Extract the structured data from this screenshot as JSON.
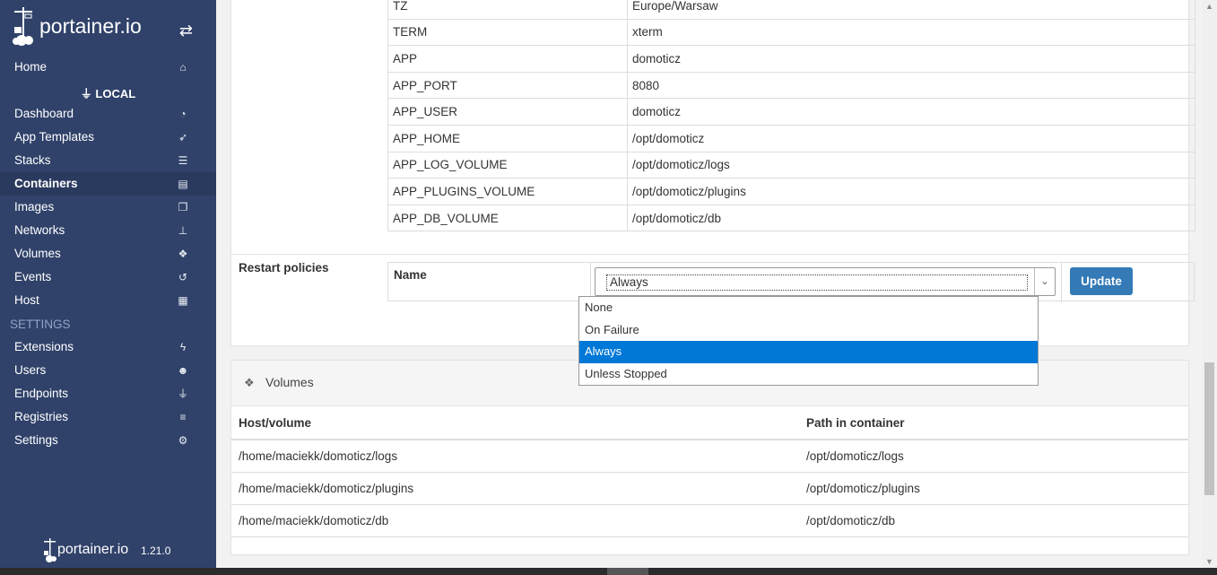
{
  "sidebar": {
    "brand": "portainer.io",
    "toggle_icon": "exchange-icon",
    "endpoint_label": "LOCAL",
    "settings_title": "SETTINGS",
    "items": [
      {
        "label": "Home",
        "icon": "home-icon"
      },
      {
        "label": "Dashboard",
        "icon": "tachometer-icon"
      },
      {
        "label": "App Templates",
        "icon": "rocket-icon"
      },
      {
        "label": "Stacks",
        "icon": "th-list-icon"
      },
      {
        "label": "Containers",
        "icon": "server-icon",
        "active": true
      },
      {
        "label": "Images",
        "icon": "clone-icon"
      },
      {
        "label": "Networks",
        "icon": "sitemap-icon"
      },
      {
        "label": "Volumes",
        "icon": "cubes-icon"
      },
      {
        "label": "Events",
        "icon": "history-icon"
      },
      {
        "label": "Host",
        "icon": "th-icon"
      }
    ],
    "settings_items": [
      {
        "label": "Extensions",
        "icon": "bolt-icon"
      },
      {
        "label": "Users",
        "icon": "users-icon"
      },
      {
        "label": "Endpoints",
        "icon": "plug-icon"
      },
      {
        "label": "Registries",
        "icon": "database-icon"
      },
      {
        "label": "Settings",
        "icon": "cogs-icon"
      }
    ],
    "footer_brand": "portainer.io",
    "version": "1.21.0"
  },
  "env": {
    "rows": [
      {
        "key": "TZ",
        "value": "Europe/Warsaw"
      },
      {
        "key": "TERM",
        "value": "xterm"
      },
      {
        "key": "APP",
        "value": "domoticz"
      },
      {
        "key": "APP_PORT",
        "value": "8080"
      },
      {
        "key": "APP_USER",
        "value": "domoticz"
      },
      {
        "key": "APP_HOME",
        "value": "/opt/domoticz"
      },
      {
        "key": "APP_LOG_VOLUME",
        "value": "/opt/domoticz/logs"
      },
      {
        "key": "APP_PLUGINS_VOLUME",
        "value": "/opt/domoticz/plugins"
      },
      {
        "key": "APP_DB_VOLUME",
        "value": "/opt/domoticz/db"
      }
    ]
  },
  "restart": {
    "label": "Restart policies",
    "name_label": "Name",
    "selected": "Always",
    "options": [
      "None",
      "On Failure",
      "Always",
      "Unless Stopped"
    ],
    "update_label": "Update"
  },
  "volumes": {
    "title": "Volumes",
    "icon": "cubes-icon",
    "col_host": "Host/volume",
    "col_path": "Path in container",
    "rows": [
      {
        "host": "/home/maciekk/domoticz/logs",
        "path": "/opt/domoticz/logs"
      },
      {
        "host": "/home/maciekk/domoticz/plugins",
        "path": "/opt/domoticz/plugins"
      },
      {
        "host": "/home/maciekk/domoticz/db",
        "path": "/opt/domoticz/db"
      }
    ]
  },
  "colors": {
    "sidebar_bg": "#30426a",
    "accent": "#337ab7",
    "dropdown_selected": "#0078d7"
  }
}
